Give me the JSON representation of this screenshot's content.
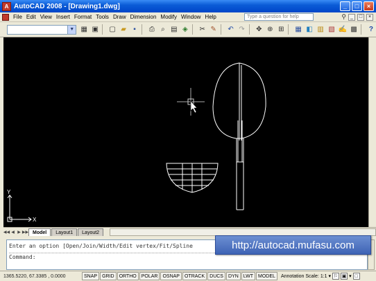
{
  "window": {
    "title": "AutoCAD 2008 - [Drawing1.dwg]",
    "app_icon_label": "A",
    "buttons": [
      "_",
      "□",
      "×"
    ]
  },
  "menu": {
    "items": [
      "File",
      "Edit",
      "View",
      "Insert",
      "Format",
      "Tools",
      "Draw",
      "Dimension",
      "Modify",
      "Window",
      "Help"
    ],
    "help_placeholder": "Type a question for help",
    "right_buttons": [
      "_",
      "□",
      "×"
    ]
  },
  "toolbar": {
    "workspace_value": "",
    "icons": [
      "layer-icon",
      "grid-icon",
      "new-icon",
      "open-icon",
      "save-icon",
      "print-icon",
      "preview-icon",
      "plot-icon",
      "publish-icon",
      "cut-icon",
      "copy-icon",
      "paste-icon",
      "matchprop-icon",
      "undo-icon",
      "redo-icon",
      "pan-icon",
      "zoom-icon",
      "zoom-window-icon",
      "properties-icon",
      "designcenter-icon",
      "toolpalette-icon",
      "sheetset-icon",
      "markup-icon",
      "calc-icon",
      "help-icon"
    ]
  },
  "canvas": {
    "ucs_x_label": "X",
    "ucs_y_label": "Y"
  },
  "tabs": {
    "items": [
      "Model",
      "Layout1",
      "Layout2"
    ],
    "active": "Model"
  },
  "command": {
    "line1": "Enter an option [Open/Join/Width/Edit vertex/Fit/Spline",
    "prompt": "Command:"
  },
  "watermark": "http://autocad.mufasu.com",
  "status": {
    "coordinates": "1365.5220, 67.3385 , 0.0000",
    "toggles": [
      "SNAP",
      "GRID",
      "ORTHO",
      "POLAR",
      "OSNAP",
      "OTRACK",
      "DUCS",
      "DYN",
      "LWT",
      "MODEL"
    ],
    "annotation_label": "Annotation Scale:",
    "annotation_value": "1:1"
  }
}
